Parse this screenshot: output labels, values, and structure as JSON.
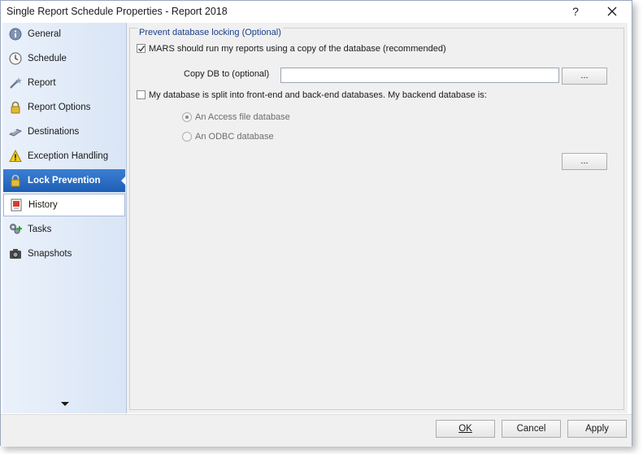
{
  "window": {
    "title": "Single Report Schedule Properties - Report 2018",
    "help_label": "?"
  },
  "sidebar": {
    "items": [
      {
        "label": "General",
        "icon": "info-icon"
      },
      {
        "label": "Schedule",
        "icon": "clock-icon"
      },
      {
        "label": "Report",
        "icon": "report-wand-icon"
      },
      {
        "label": "Report Options",
        "icon": "lock-icon"
      },
      {
        "label": "Destinations",
        "icon": "destination-icon"
      },
      {
        "label": "Exception Handling",
        "icon": "warning-icon"
      },
      {
        "label": "Lock Prevention",
        "icon": "lock-icon",
        "active": true
      },
      {
        "label": "History",
        "icon": "history-icon"
      },
      {
        "label": "Tasks",
        "icon": "tasks-icon"
      },
      {
        "label": "Snapshots",
        "icon": "camera-icon"
      }
    ]
  },
  "lock_prevention": {
    "group_title": "Prevent database locking (Optional)",
    "copy_db_checkbox": {
      "label": "MARS should run my reports using a copy of the database (recommended)",
      "checked": true
    },
    "copy_db_to_label": "Copy DB to (optional)",
    "copy_db_to_value": "",
    "browse_label": "...",
    "split_db_checkbox": {
      "label": "My database is split into front-end and back-end databases. My backend database is:",
      "checked": false
    },
    "access_radio": {
      "label": "An Access file database",
      "selected": true
    },
    "odbc_radio": {
      "label": "An ODBC database",
      "selected": false
    },
    "backend_browse_label": "..."
  },
  "footer": {
    "ok_label": "OK",
    "cancel_label": "Cancel",
    "apply_label": "Apply"
  },
  "colors": {
    "active_nav": "#2a6cc6",
    "group_title": "#1a3e8a"
  }
}
